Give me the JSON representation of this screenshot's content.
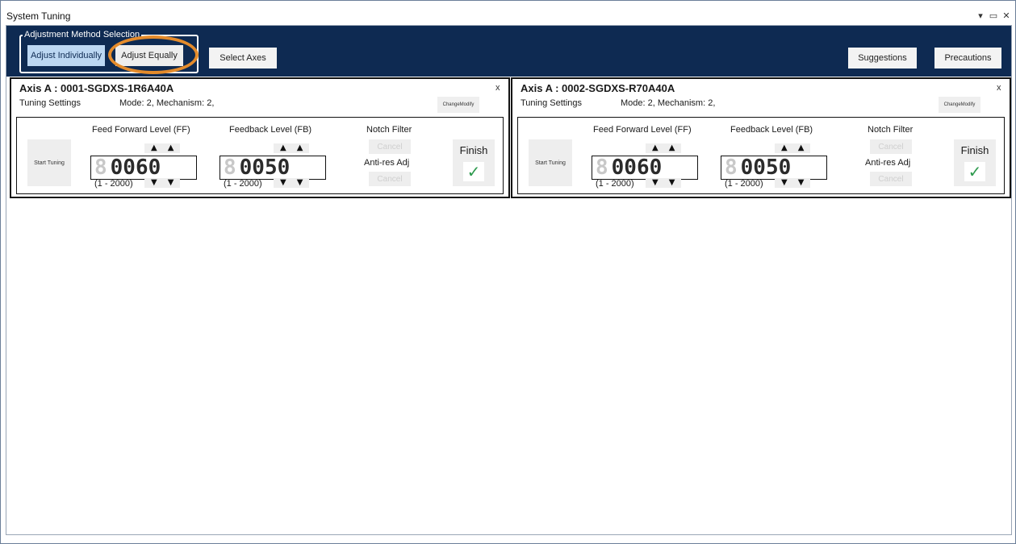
{
  "window": {
    "title": "System Tuning",
    "controls": {
      "menu": "▾",
      "restore": "▭",
      "close": "✕"
    }
  },
  "toolbar": {
    "method_group_label": "Adjustment Method Selection",
    "adjust_individually": "Adjust Individually",
    "adjust_equally": "Adjust Equally",
    "select_axes": "Select Axes",
    "suggestions": "Suggestions",
    "precautions": "Precautions"
  },
  "colors": {
    "header_bg": "#0e2a52",
    "selected_button": "#bcd7f2",
    "highlight_ring": "#e48b2b",
    "check_green": "#2e9a4e"
  },
  "axes": [
    {
      "title": "Axis A : 0001-SGDXS-1R6A40A",
      "close": "x",
      "tuning_settings": "Tuning Settings",
      "mode": "Mode: 2, Mechanism: 2,",
      "change_modify": "ChangeModify",
      "start_tuning": "Start Tuning",
      "ff_label": "Feed Forward Level (FF)",
      "fb_label": "Feedback Level (FB)",
      "ff_dim": "8",
      "ff_value": "0060",
      "fb_dim": "8",
      "fb_value": "0050",
      "ff_range": "(1 - 2000)",
      "fb_range": "(1 - 2000)",
      "notch_filter": "Notch Filter",
      "antires": "Anti-res Adj",
      "cancel": "Cancel",
      "finish": "Finish",
      "check_icon": "✓"
    },
    {
      "title": "Axis A : 0002-SGDXS-R70A40A",
      "close": "x",
      "tuning_settings": "Tuning Settings",
      "mode": "Mode: 2, Mechanism: 2,",
      "change_modify": "ChangeModify",
      "start_tuning": "Start Tuning",
      "ff_label": "Feed Forward Level (FF)",
      "fb_label": "Feedback Level (FB)",
      "ff_dim": "8",
      "ff_value": "0060",
      "fb_dim": "8",
      "fb_value": "0050",
      "ff_range": "(1 - 2000)",
      "fb_range": "(1 - 2000)",
      "notch_filter": "Notch Filter",
      "antires": "Anti-res Adj",
      "cancel": "Cancel",
      "finish": "Finish",
      "check_icon": "✓"
    }
  ],
  "arrows": {
    "up": "▲",
    "down": "▼"
  }
}
